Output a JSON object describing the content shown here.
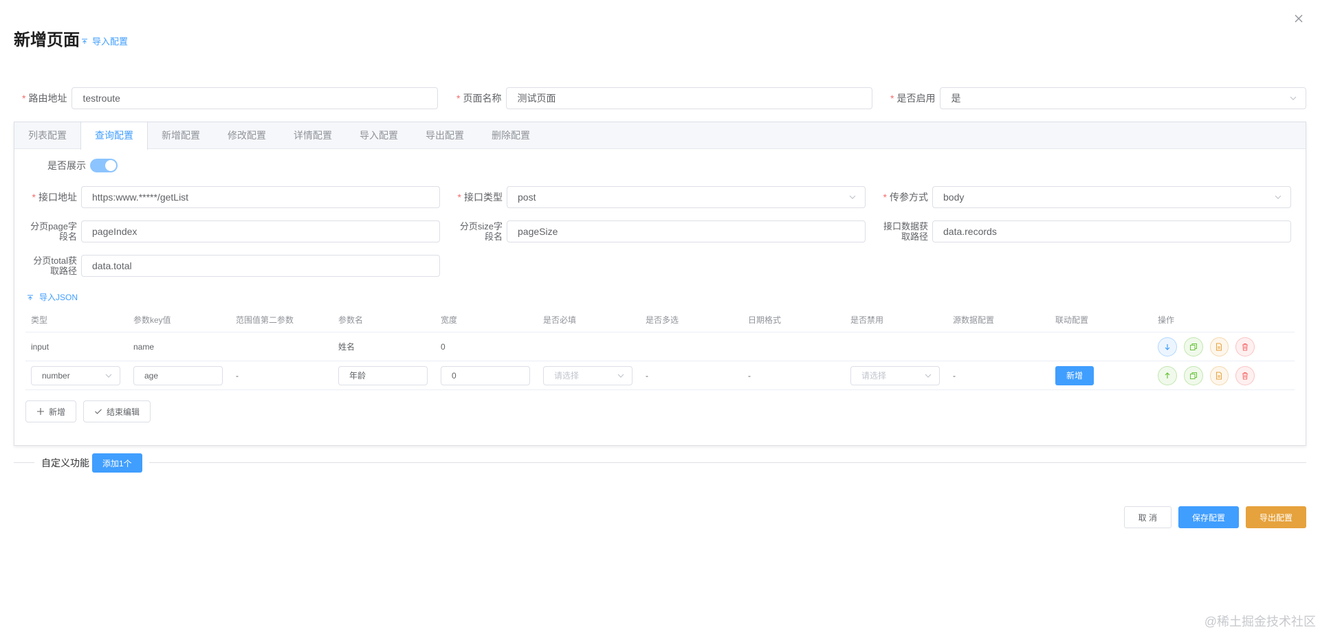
{
  "dialog": {
    "title": "新增页面",
    "import_config_link": "导入配置"
  },
  "top_form": {
    "route": {
      "label": "路由地址",
      "value": "testroute"
    },
    "page_name": {
      "label": "页面名称",
      "value": "测试页面"
    },
    "enabled": {
      "label": "是否启用",
      "value": "是"
    }
  },
  "tabs": [
    {
      "label": "列表配置"
    },
    {
      "label": "查询配置"
    },
    {
      "label": "新增配置"
    },
    {
      "label": "修改配置"
    },
    {
      "label": "详情配置"
    },
    {
      "label": "导入配置"
    },
    {
      "label": "导出配置"
    },
    {
      "label": "删除配置"
    }
  ],
  "query": {
    "show_label": "是否展示",
    "show_enabled": true,
    "api_url": {
      "label": "接口地址",
      "value": "https:www.*****/getList"
    },
    "api_type": {
      "label": "接口类型",
      "value": "post"
    },
    "param_mode": {
      "label": "传参方式",
      "value": "body"
    },
    "page_field_l1": "分页page字",
    "page_field_l2": "段名",
    "page_field_value": "pageIndex",
    "size_field_l1": "分页size字",
    "size_field_l2": "段名",
    "size_field_value": "pageSize",
    "data_path_l1": "接口数据获",
    "data_path_l2": "取路径",
    "data_path_value": "data.records",
    "total_path_l1": "分页total获",
    "total_path_l2": "取路径",
    "total_path_value": "data.total",
    "import_json": "导入JSON"
  },
  "table": {
    "headers": [
      "类型",
      "参数key值",
      "范围值第二参数",
      "参数名",
      "宽度",
      "是否必填",
      "是否多选",
      "日期格式",
      "是否禁用",
      "源数据配置",
      "联动配置",
      "操作"
    ],
    "row1": {
      "type": "input",
      "key": "name",
      "name": "姓名",
      "width": "0"
    },
    "row2": {
      "type": "number",
      "key": "age",
      "second_param": "-",
      "name": "年龄",
      "width": "0",
      "required_placeholder": "请选择",
      "multi": "-",
      "date_format": "-",
      "disabled_placeholder": "请选择",
      "source": "-",
      "linkage_button": "新增"
    },
    "add_button": "新增",
    "finish_button": "结束编辑"
  },
  "custom": {
    "label": "自定义功能",
    "add_button": "添加1个"
  },
  "footer": {
    "cancel": "取 消",
    "save": "保存配置",
    "export": "导出配置"
  },
  "watermark": "@稀土掘金技术社区",
  "colors": {
    "primary": "#409eff",
    "warning": "#e6a23c",
    "success": "#67c23a",
    "danger": "#f56c6c",
    "required": "#f56c6c"
  }
}
